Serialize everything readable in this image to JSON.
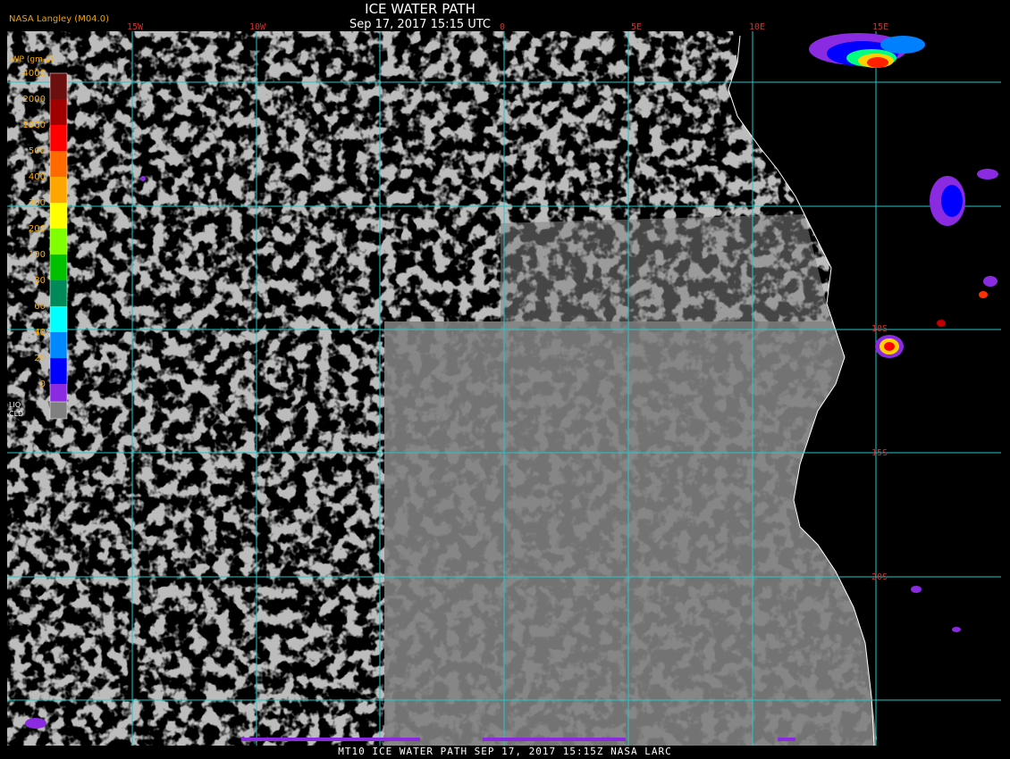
{
  "title": "ICE WATER PATH",
  "subtitle": "Sep 17, 2017 15:15 UTC",
  "credit": "NASA Langley (M04.0)",
  "footer": "MT10  ICE WATER PATH  SEP 17, 2017 15:15Z  NASA LARC",
  "legend": {
    "unit": "IWP (gm-2)",
    "levels": [
      {
        "label": "4000",
        "color": "#6b0f0f"
      },
      {
        "label": "2000",
        "color": "#a00000"
      },
      {
        "label": "1000",
        "color": "#ff0000"
      },
      {
        "label": "500",
        "color": "#ff6a00"
      },
      {
        "label": "400",
        "color": "#ffa500"
      },
      {
        "label": "300",
        "color": "#ffff00"
      },
      {
        "label": "200",
        "color": "#7fff00"
      },
      {
        "label": "100",
        "color": "#00c000"
      },
      {
        "label": "80",
        "color": "#008a5a"
      },
      {
        "label": "60",
        "color": "#00ffff"
      },
      {
        "label": "40",
        "color": "#0088ff"
      },
      {
        "label": "20",
        "color": "#0000ff"
      },
      {
        "label": "0",
        "color": "#8a2be2"
      }
    ],
    "liquid_label_1": "LIQ",
    "liquid_label_2": "CLD",
    "liquid_color": "#808080"
  },
  "longitude_labels": [
    "15W",
    "10W",
    "0",
    "5E",
    "10E",
    "15E"
  ],
  "latitude_labels": [
    "10S",
    "15S",
    "20S"
  ],
  "colors": {
    "background": "#000000",
    "cloud_gray": "#808080",
    "grid": "#20c8c8",
    "coast": "#ffffff",
    "label_red": "#d03030"
  }
}
